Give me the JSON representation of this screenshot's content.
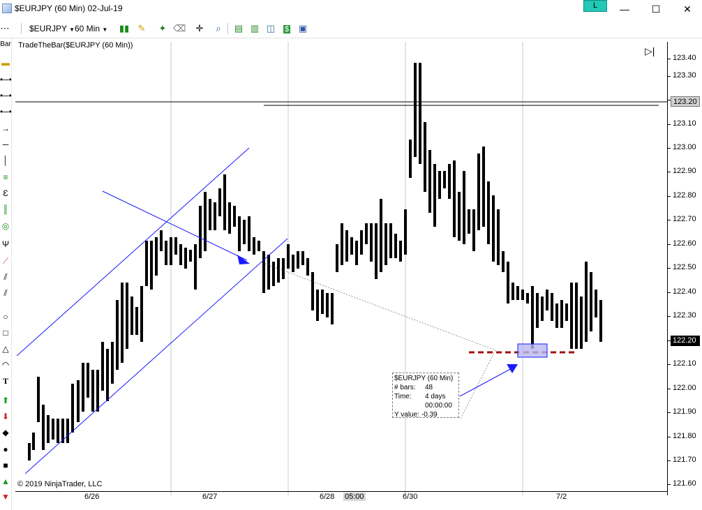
{
  "window": {
    "title": "$EURJPY (60 Min)  02-Jul-19",
    "link_button": "L",
    "minimize": "—",
    "maximize": "☐",
    "close": "✕"
  },
  "toolbar": {
    "instrument": "$EURJPY",
    "interval": "60 Min",
    "icons": [
      "bar-style-icon",
      "pencil-icon",
      "magic-wand-icon",
      "eraser-icon",
      "crosshair-icon",
      "zoom-icon",
      "strategies-icon",
      "indicators-icon",
      "chart-trader-icon",
      "money-icon",
      "properties-icon"
    ]
  },
  "left_toolbar": {
    "top_label": "Bar",
    "icons": [
      "line-icon",
      "ray-icon",
      "extended-line-icon",
      "arrow-line-icon",
      "horizontal-line-icon",
      "vertical-line-icon",
      "fibonacci-icon",
      "fib-time-icon",
      "fib-circle-icon",
      "andrews-pitchfork-icon",
      "gann-fan-icon",
      "regression-channel-icon",
      "trend-channel-icon",
      "ellipse-icon",
      "rectangle-icon",
      "triangle-icon",
      "arc-icon",
      "text-icon",
      "arrow-up-icon",
      "arrow-down-icon",
      "diamond-icon",
      "dot-icon",
      "square-icon",
      "triangle-up-icon",
      "triangle-down-icon"
    ],
    "text_icon": "T"
  },
  "chart": {
    "indicator_label": "TradeTheBar($EURJPY (60 Min))",
    "copyright": "© 2019 NinjaTrader, LLC",
    "price_ticks": [
      "123.40",
      "123.30",
      "123.20",
      "123.10",
      "123.00",
      "122.90",
      "122.80",
      "122.70",
      "122.60",
      "122.50",
      "122.40",
      "122.30",
      "122.20",
      "122.10",
      "122.00",
      "121.90",
      "121.80",
      "121.70",
      "121.60"
    ],
    "extra_tick": "123.40",
    "horizontal_line_label": "123.20",
    "last_price_label": "122.20",
    "date_ticks": [
      "6/26",
      "6/27",
      "6/28",
      "05:00",
      "6/30",
      "7/2"
    ],
    "colors": {
      "drawing_blue": "#1a1aff",
      "bars": "#000000",
      "target_line": "#a01010",
      "target_box": "#b8b8f0"
    },
    "tooltip": {
      "title": "$EURJPY (60 Min)",
      "bars_label": "# bars:",
      "bars_value": "48",
      "time_label": "Time:",
      "time_value": "4 days",
      "time_value2": "00:00:00",
      "y_label": "Y value:",
      "y_value": "-0.39"
    }
  }
}
